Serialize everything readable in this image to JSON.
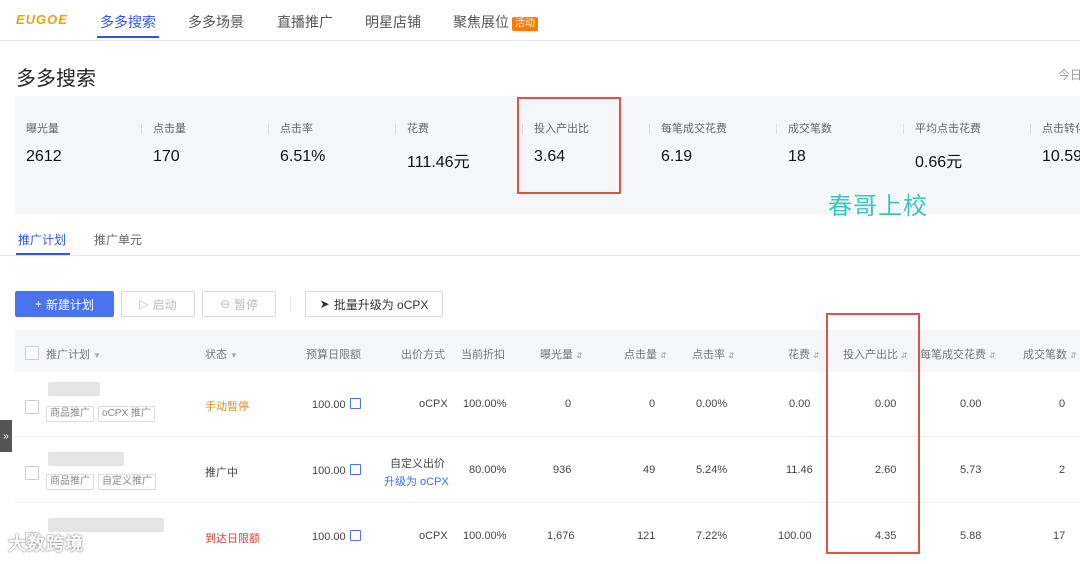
{
  "nav": {
    "logo": "EUGOE",
    "tabs": [
      "多多搜索",
      "多多场景",
      "直播推广",
      "明星店铺",
      "聚焦展位"
    ],
    "badge": "活动"
  },
  "page": {
    "title": "多多搜索",
    "date_hint": "今日"
  },
  "stats": [
    {
      "label": "曝光量",
      "value": "2612"
    },
    {
      "label": "点击量",
      "value": "170"
    },
    {
      "label": "点击率",
      "value": "6.51%"
    },
    {
      "label": "花费",
      "value": "111.46元"
    },
    {
      "label": "投入产出比",
      "value": "3.64"
    },
    {
      "label": "每笔成交花费",
      "value": "6.19"
    },
    {
      "label": "成交笔数",
      "value": "18"
    },
    {
      "label": "平均点击花费",
      "value": "0.66元"
    },
    {
      "label": "点击转化",
      "value": "10.59"
    }
  ],
  "watermark": "春哥上校",
  "subtabs": [
    "推广计划",
    "推广单元"
  ],
  "toolbar": {
    "new": "新建计划",
    "start": "启动",
    "pause": "暂停",
    "upgrade": "批量升级为 oCPX"
  },
  "columns": [
    "推广计划",
    "状态",
    "预算日限额",
    "出价方式",
    "当前折扣",
    "曝光量",
    "点击量",
    "点击率",
    "花费",
    "投入产出比",
    "每笔成交花费",
    "成交笔数"
  ],
  "rows": [
    {
      "tags": [
        "商品推广",
        "oCPX 推广"
      ],
      "status": "手动暂停",
      "budget": "100.00",
      "bid": "oCPX",
      "bid_link": "",
      "discount": "100.00%",
      "impressions": "0",
      "clicks": "0",
      "ctr": "0.00%",
      "spend": "0.00",
      "roi": "0.00",
      "cost_per_order": "0.00",
      "orders": "0"
    },
    {
      "tags": [
        "商品推广",
        "自定义推广"
      ],
      "status": "推广中",
      "budget": "100.00",
      "bid": "自定义出价",
      "bid_link": "升级为 oCPX",
      "discount": "80.00%",
      "impressions": "936",
      "clicks": "49",
      "ctr": "5.24%",
      "spend": "11.46",
      "roi": "2.60",
      "cost_per_order": "5.73",
      "orders": "2"
    },
    {
      "tags": [],
      "status": "到达日限额",
      "budget": "100.00",
      "bid": "oCPX",
      "bid_link": "",
      "discount": "100.00%",
      "impressions": "1,676",
      "clicks": "121",
      "ctr": "7.22%",
      "spend": "100.00",
      "roi": "4.35",
      "cost_per_order": "5.88",
      "orders": "17"
    }
  ],
  "footer_watermark": "大数跨境",
  "collapse_icon": "»"
}
